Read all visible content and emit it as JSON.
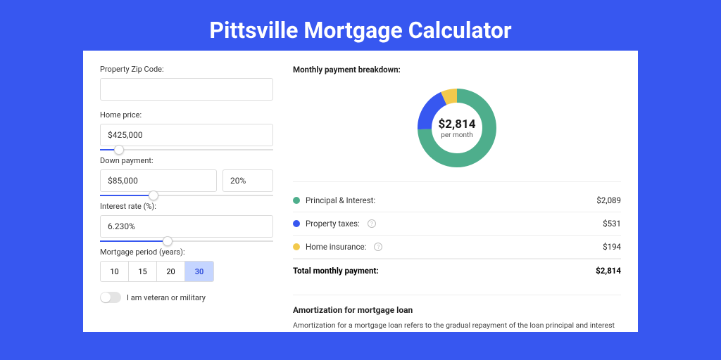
{
  "title": "Pittsville Mortgage Calculator",
  "inputs": {
    "zip": {
      "label": "Property Zip Code:",
      "value": ""
    },
    "price": {
      "label": "Home price:",
      "value": "$425,000",
      "slider_pct": 8
    },
    "down": {
      "label": "Down payment:",
      "amount": "$85,000",
      "pct": "20%",
      "slider_pct": 28
    },
    "rate": {
      "label": "Interest rate (%):",
      "value": "6.230%",
      "slider_pct": 36
    },
    "period": {
      "label": "Mortgage period (years):",
      "options": [
        "10",
        "15",
        "20",
        "30"
      ],
      "active": "30"
    },
    "veteran": {
      "label": "I am veteran or military",
      "checked": false
    }
  },
  "breakdown": {
    "heading": "Monthly payment breakdown:",
    "total": "$2,814",
    "sub": "per month",
    "items": [
      {
        "label": "Principal & Interest:",
        "value": "$2,089",
        "color": "#4EAE8C",
        "info": false
      },
      {
        "label": "Property taxes:",
        "value": "$531",
        "color": "#3757F0",
        "info": true
      },
      {
        "label": "Home insurance:",
        "value": "$194",
        "color": "#F2C94C",
        "info": true
      }
    ],
    "total_label": "Total monthly payment:",
    "total_value": "$2,814"
  },
  "chart_data": {
    "type": "pie",
    "title": "Monthly payment breakdown",
    "categories": [
      "Principal & Interest",
      "Property taxes",
      "Home insurance"
    ],
    "values": [
      2089,
      531,
      194
    ],
    "colors": [
      "#4EAE8C",
      "#3757F0",
      "#F2C94C"
    ],
    "total": 2814
  },
  "amortization": {
    "heading": "Amortization for mortgage loan",
    "text": "Amortization for a mortgage loan refers to the gradual repayment of the loan principal and interest over a specified"
  }
}
